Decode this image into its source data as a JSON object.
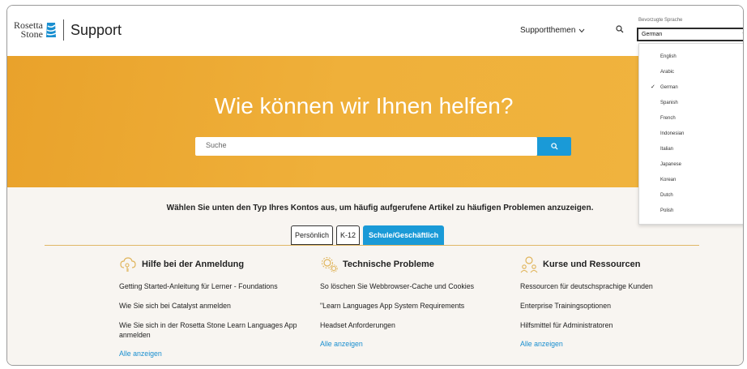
{
  "header": {
    "logo_line1": "Rosetta",
    "logo_line2": "Stone",
    "support_label": "Support",
    "nav_topics_label": "Supportthemen",
    "language_label": "Bevorzugte Sprache",
    "language_selected": "German"
  },
  "language_options": [
    {
      "label": "English",
      "selected": false
    },
    {
      "label": "Arabic",
      "selected": false
    },
    {
      "label": "German",
      "selected": true
    },
    {
      "label": "Spanish",
      "selected": false
    },
    {
      "label": "French",
      "selected": false
    },
    {
      "label": "Indonesian",
      "selected": false
    },
    {
      "label": "Italian",
      "selected": false
    },
    {
      "label": "Japanese",
      "selected": false
    },
    {
      "label": "Korean",
      "selected": false
    },
    {
      "label": "Dutch",
      "selected": false
    },
    {
      "label": "Polish",
      "selected": false
    }
  ],
  "hero": {
    "title": "Wie können wir Ihnen helfen?",
    "search_placeholder": "Suche"
  },
  "account": {
    "instruction": "Wählen Sie unten den Typ Ihres Kontos aus, um häufig aufgerufene Artikel zu häufigen Problemen anzuzeigen.",
    "tabs": [
      {
        "label": "Persönlich",
        "active": false
      },
      {
        "label": "K-12",
        "active": false
      },
      {
        "label": "Schule/Geschäftlich",
        "active": true
      }
    ]
  },
  "sections": [
    {
      "title": "Hilfe bei der Anmeldung",
      "icon": "cloud-key-icon",
      "links": [
        "Getting Started-Anleitung für Lerner - Foundations",
        "Wie Sie sich bei Catalyst anmelden",
        "Wie Sie sich in der Rosetta Stone Learn Languages App anmelden"
      ],
      "more": "Alle anzeigen"
    },
    {
      "title": "Technische Probleme",
      "icon": "gears-icon",
      "links": [
        "So löschen Sie Webbrowser-Cache und Cookies",
        "\"Learn Languages App System Requirements",
        "Headset Anforderungen"
      ],
      "more": "Alle anzeigen"
    },
    {
      "title": "Kurse und Ressourcen",
      "icon": "people-icon",
      "links": [
        "Ressourcen für deutschsprachige Kunden",
        "Enterprise Trainingsoptionen",
        "Hilfsmittel für Administratoren"
      ],
      "more": "Alle anzeigen"
    }
  ],
  "colors": {
    "hero_orange": "#efb03a",
    "accent_blue": "#1a9ad7",
    "icon_gold": "#e0b45a"
  }
}
